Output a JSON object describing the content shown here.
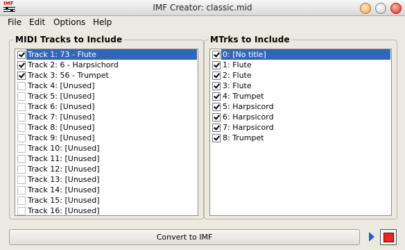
{
  "window": {
    "title": "IMF Creator: classic.mid",
    "icon_tag": "IMF",
    "icon": "music-staff-icon",
    "controls": [
      "minimize-icon",
      "maximize-icon",
      "close-icon"
    ]
  },
  "menu": {
    "file": "File",
    "edit": "Edit",
    "options": "Options",
    "help": "Help"
  },
  "midi_tracks": {
    "title": "MIDI Tracks to Include",
    "items": [
      {
        "label": "Track 1: 73 - Flute",
        "checked": true,
        "selected": true
      },
      {
        "label": "Track 2: 6 - Harpsichord",
        "checked": true,
        "selected": false
      },
      {
        "label": "Track 3: 56 - Trumpet",
        "checked": true,
        "selected": false
      },
      {
        "label": "Track 4: [Unused]",
        "checked": false,
        "selected": false
      },
      {
        "label": "Track 5: [Unused]",
        "checked": false,
        "selected": false
      },
      {
        "label": "Track 6: [Unused]",
        "checked": false,
        "selected": false
      },
      {
        "label": "Track 7: [Unused]",
        "checked": false,
        "selected": false
      },
      {
        "label": "Track 8: [Unused]",
        "checked": false,
        "selected": false
      },
      {
        "label": "Track 9: [Unused]",
        "checked": false,
        "selected": false
      },
      {
        "label": "Track 10: [Unused]",
        "checked": false,
        "selected": false
      },
      {
        "label": "Track 11: [Unused]",
        "checked": false,
        "selected": false
      },
      {
        "label": "Track 12: [Unused]",
        "checked": false,
        "selected": false
      },
      {
        "label": "Track 13: [Unused]",
        "checked": false,
        "selected": false
      },
      {
        "label": "Track 14: [Unused]",
        "checked": false,
        "selected": false
      },
      {
        "label": "Track 15: [Unused]",
        "checked": false,
        "selected": false
      },
      {
        "label": "Track 16: [Unused]",
        "checked": false,
        "selected": false
      }
    ]
  },
  "mtrks": {
    "title": "MTrks to Include",
    "items": [
      {
        "label": "0: [No title]",
        "checked": true,
        "selected": true
      },
      {
        "label": "1: Flute",
        "checked": true,
        "selected": false
      },
      {
        "label": "2: Flute",
        "checked": true,
        "selected": false
      },
      {
        "label": "3: Flute",
        "checked": true,
        "selected": false
      },
      {
        "label": "4: Trumpet",
        "checked": true,
        "selected": false
      },
      {
        "label": "5: Harpsicord",
        "checked": true,
        "selected": false
      },
      {
        "label": "6: Harpsicord",
        "checked": true,
        "selected": false
      },
      {
        "label": "7: Harpsicord",
        "checked": true,
        "selected": false
      },
      {
        "label": "8: Trumpet",
        "checked": true,
        "selected": false
      }
    ]
  },
  "actions": {
    "convert_label": "Convert to IMF",
    "play_icon": "play-icon",
    "stop_icon": "stop-icon"
  },
  "colors": {
    "selection": "#2f68b9",
    "window_bg": "#ece9e0",
    "stop_red": "#e8281c",
    "play_blue": "#1f5fd0"
  }
}
